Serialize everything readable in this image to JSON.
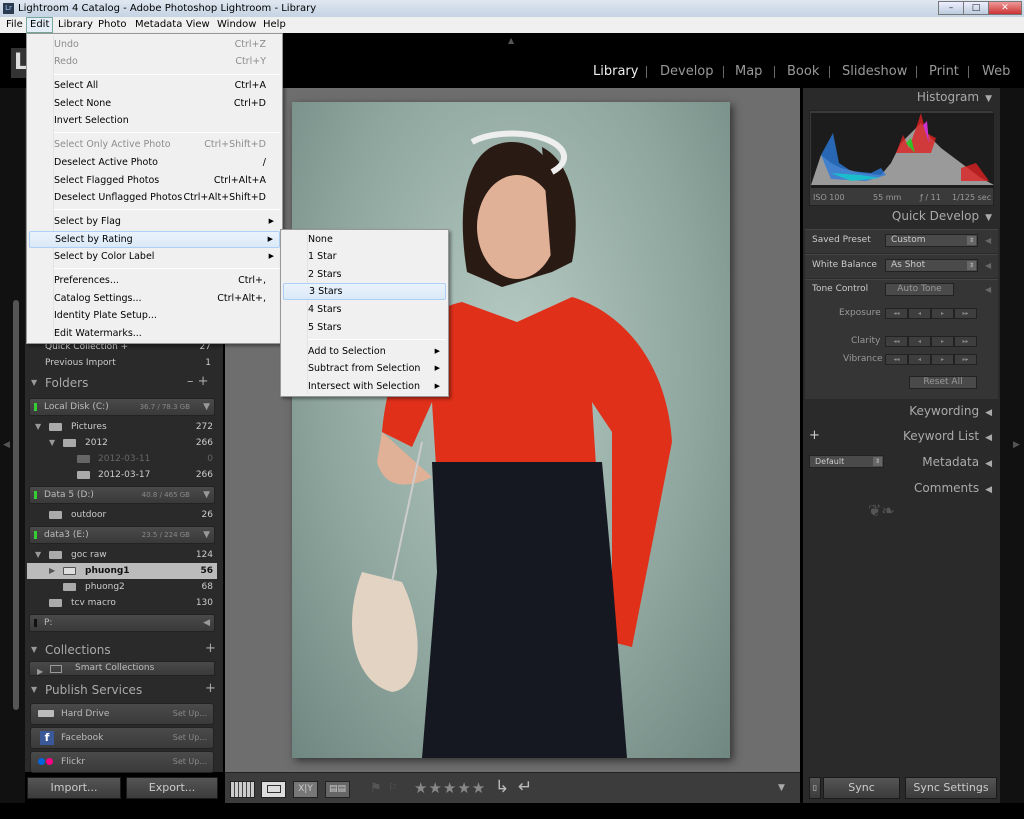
{
  "window": {
    "title": "Lightroom 4 Catalog - Adobe Photoshop Lightroom - Library",
    "app_icon": "Lr",
    "buttons": [
      "minimize",
      "maximize",
      "close"
    ]
  },
  "menubar": [
    "File",
    "Edit",
    "Library",
    "Photo",
    "Metadata",
    "View",
    "Window",
    "Help"
  ],
  "logo": "L",
  "modules": [
    "Library",
    "Develop",
    "Map",
    "Book",
    "Slideshow",
    "Print",
    "Web"
  ],
  "edit_menu": [
    {
      "label": "Undo",
      "shortcut": "Ctrl+Z",
      "disabled": true
    },
    {
      "label": "Redo",
      "shortcut": "Ctrl+Y",
      "disabled": true
    },
    {
      "label": "Select All",
      "shortcut": "Ctrl+A"
    },
    {
      "label": "Select None",
      "shortcut": "Ctrl+D"
    },
    {
      "label": "Invert Selection",
      "shortcut": ""
    },
    {
      "label": "Select Only Active Photo",
      "shortcut": "Ctrl+Shift+D",
      "disabled": true
    },
    {
      "label": "Deselect Active Photo",
      "shortcut": "/"
    },
    {
      "label": "Select Flagged Photos",
      "shortcut": "Ctrl+Alt+A"
    },
    {
      "label": "Deselect Unflagged Photos",
      "shortcut": "Ctrl+Alt+Shift+D"
    },
    {
      "label": "Select by Flag",
      "submenu": true
    },
    {
      "label": "Select by Rating",
      "submenu": true,
      "highlighted": true
    },
    {
      "label": "Select by Color Label",
      "submenu": true
    },
    {
      "label": "Preferences...",
      "shortcut": "Ctrl+,"
    },
    {
      "label": "Catalog Settings...",
      "shortcut": "Ctrl+Alt+,"
    },
    {
      "label": "Identity Plate Setup...",
      "shortcut": ""
    },
    {
      "label": "Edit Watermarks...",
      "shortcut": ""
    }
  ],
  "rating_submenu": [
    {
      "label": "None"
    },
    {
      "label": "1 Star"
    },
    {
      "label": "2 Stars"
    },
    {
      "label": "3 Stars",
      "highlighted": true
    },
    {
      "label": "4 Stars"
    },
    {
      "label": "5 Stars"
    },
    {
      "label": "Add to Selection",
      "submenu": true
    },
    {
      "label": "Subtract from Selection",
      "submenu": true
    },
    {
      "label": "Intersect with Selection",
      "submenu": true
    }
  ],
  "catalog": [
    {
      "label": "Quick Collection +",
      "count": "27"
    },
    {
      "label": "Previous Import",
      "count": "1"
    }
  ],
  "folders": {
    "title": "Folders",
    "volumes": [
      {
        "name": "Local Disk (C:)",
        "size": "36.7 / 78.3 GB"
      },
      {
        "name": "Data 5 (D:)",
        "size": "40.8 / 465 GB"
      },
      {
        "name": "data3 (E:)",
        "size": "23.5 / 224 GB"
      },
      {
        "name": "P:",
        "size": ""
      }
    ],
    "items": [
      {
        "name": "Pictures",
        "count": "272"
      },
      {
        "name": "2012",
        "count": "266"
      },
      {
        "name": "2012-03-11",
        "count": "0"
      },
      {
        "name": "2012-03-17",
        "count": "266"
      },
      {
        "name": "outdoor",
        "count": "26"
      },
      {
        "name": "goc raw",
        "count": "124"
      },
      {
        "name": "phuong1",
        "count": "56",
        "selected": true
      },
      {
        "name": "phuong2",
        "count": "68"
      },
      {
        "name": "tcv macro",
        "count": "130"
      }
    ]
  },
  "collections": {
    "title": "Collections",
    "items": [
      "Smart Collections"
    ]
  },
  "publish": {
    "title": "Publish Services",
    "items": [
      {
        "name": "Hard Drive",
        "action": "Set Up..."
      },
      {
        "name": "Facebook",
        "action": "Set Up..."
      },
      {
        "name": "Flickr",
        "action": "Set Up..."
      }
    ]
  },
  "import_label": "Import...",
  "export_label": "Export...",
  "histogram": {
    "title": "Histogram",
    "iso": "ISO 100",
    "focal": "55 mm",
    "aperture": "ƒ / 11",
    "shutter": "1/125 sec"
  },
  "quick_develop": {
    "title": "Quick Develop",
    "saved_preset_label": "Saved Preset",
    "saved_preset": "Custom",
    "wb_label": "White Balance",
    "wb": "As Shot",
    "tone_label": "Tone Control",
    "auto_tone": "Auto Tone",
    "exposure": "Exposure",
    "clarity": "Clarity",
    "vibrance": "Vibrance",
    "reset": "Reset All"
  },
  "panels": {
    "keywording": "Keywording",
    "keyword_list": "Keyword List",
    "metadata": "Metadata",
    "metadata_preset": "Default",
    "comments": "Comments"
  },
  "sync": "Sync",
  "sync_settings": "Sync Settings",
  "toolbar": {
    "rating_stars": 0,
    "stars": "★★★★★"
  }
}
